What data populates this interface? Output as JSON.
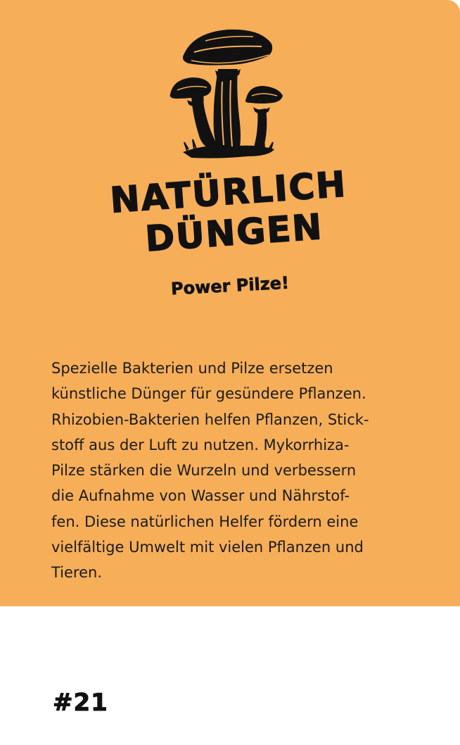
{
  "card": {
    "accent_color": "#F6AE59",
    "illustration_icon": "mushrooms-icon",
    "title_line1": "NATÜRLICH",
    "title_line2": "DÜNGEN",
    "subtitle": "Power Pilze!",
    "body": "Spezielle Bakterien und Pilze ersetzen\nkünstliche Dünger für gesündere Pflanzen.\nRhizobien-Bakterien helfen Pflanzen, Stick-\nstoff aus der Luft zu nutzen. Mykorrhiza-\nPilze stärken die Wurzeln und verbessern\ndie Aufnahme von Wasser und Nährstof-\nfen. Diese natürlichen Helfer fördern eine\nvielfältige Umwelt mit vielen Pflanzen und\nTieren.",
    "number": "#21"
  }
}
